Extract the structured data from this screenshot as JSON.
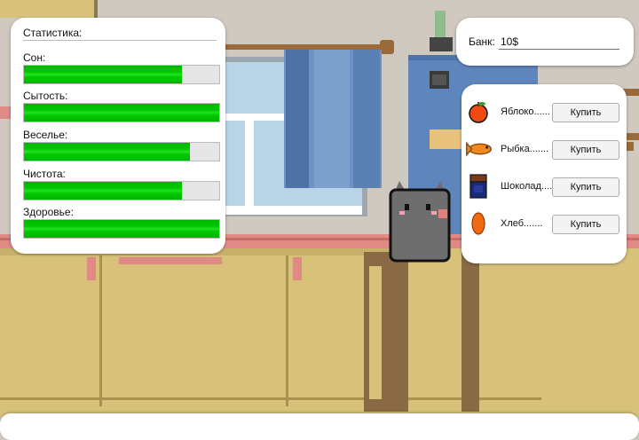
{
  "stats": {
    "title": "Статистика:",
    "items": [
      {
        "label": "Сон:",
        "value": 0.81
      },
      {
        "label": "Сытость:",
        "value": 1.0
      },
      {
        "label": "Веселье:",
        "value": 0.85
      },
      {
        "label": "Чистота:",
        "value": 0.81
      },
      {
        "label": "Здоровье:",
        "value": 1.0
      }
    ]
  },
  "bank": {
    "label": "Банк:",
    "value": "10$"
  },
  "shop": {
    "items": [
      {
        "name": "Яблоко......",
        "icon": "apple-icon",
        "button": "Купить"
      },
      {
        "name": "Рыбка.......",
        "icon": "fish-icon",
        "button": "Купить"
      },
      {
        "name": "Шоколад....",
        "icon": "chocolate-icon",
        "button": "Купить"
      },
      {
        "name": "Хлеб.......",
        "icon": "bread-icon",
        "button": "Купить"
      }
    ]
  },
  "colors": {
    "bar_fill": "#00c000",
    "wall": "#cfc9bf",
    "cabinet": "#d8c27a",
    "trim": "#e08a86"
  }
}
